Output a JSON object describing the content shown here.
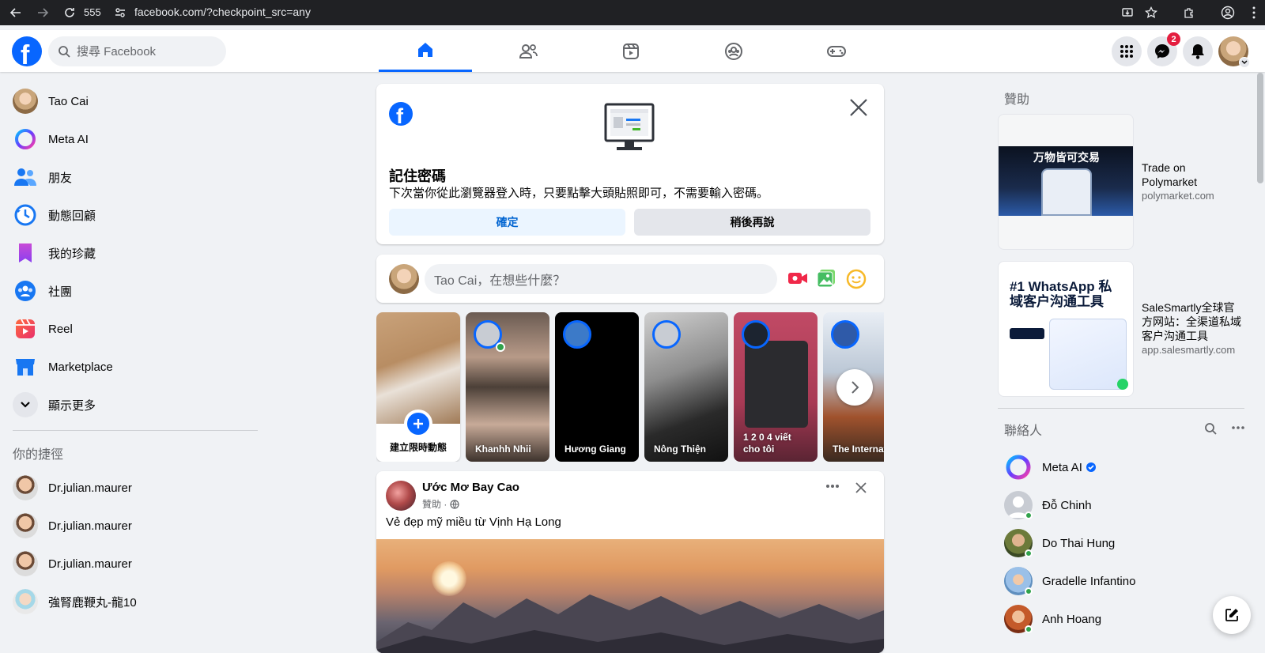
{
  "browser": {
    "tab_count": "555",
    "url": "facebook.com/?checkpoint_src=any"
  },
  "header": {
    "search_placeholder": "搜尋 Facebook",
    "messenger_badge": "2",
    "brand_color": "#0866ff",
    "nav_tabs": [
      "home-icon",
      "friends-icon",
      "video-icon",
      "groups-icon",
      "gaming-icon"
    ]
  },
  "sidebar": {
    "items": [
      {
        "label": "Tao Cai",
        "icon": "avatar"
      },
      {
        "label": "Meta AI",
        "icon": "meta-ai-icon"
      },
      {
        "label": "朋友",
        "icon": "friends-icon"
      },
      {
        "label": "動態回顧",
        "icon": "memories-icon"
      },
      {
        "label": "我的珍藏",
        "icon": "saved-icon"
      },
      {
        "label": "社團",
        "icon": "groups-icon"
      },
      {
        "label": "Reel",
        "icon": "reel-icon"
      },
      {
        "label": "Marketplace",
        "icon": "marketplace-icon"
      },
      {
        "label": "顯示更多",
        "icon": "chevron-down-icon"
      }
    ],
    "shortcuts_title": "你的捷徑",
    "shortcuts": [
      {
        "label": "Dr.julian.maurer"
      },
      {
        "label": "Dr.julian.maurer"
      },
      {
        "label": "Dr.julian.maurer"
      },
      {
        "label": "強腎鹿鞭丸-龍10"
      }
    ]
  },
  "password_card": {
    "title": "記住密碼",
    "description": "下次當你從此瀏覽器登入時，只要點擊大頭貼照即可，不需要輸入密碼。",
    "confirm_label": "確定",
    "later_label": "稍後再說"
  },
  "composer": {
    "placeholder": "Tao Cai，在想些什麼？"
  },
  "stories": {
    "create_label": "建立限時動態",
    "items": [
      {
        "name": "Khanhh Nhii"
      },
      {
        "name": "Hương Giang"
      },
      {
        "name": "Nông Thiện"
      },
      {
        "name": "1 2 0 4 viết cho tôi"
      },
      {
        "name": "The Internation"
      }
    ]
  },
  "post": {
    "author": "Ước Mơ Bay Cao",
    "meta": "贊助 ·",
    "text": "Vẻ đẹp mỹ miều từ Vịnh Hạ Long"
  },
  "sponsored": {
    "title": "贊助",
    "ads": [
      {
        "banner": "万物皆可交易",
        "title": "Trade on Polymarket",
        "domain": "polymarket.com"
      },
      {
        "banner": "#1 WhatsApp 私域客户沟通工具",
        "title": "SaleSmartly全球官方网站：全渠道私域客户沟通工具",
        "domain": "app.salesmartly.com"
      }
    ]
  },
  "contacts": {
    "title": "聯絡人",
    "items": [
      {
        "name": "Meta AI",
        "verified": true,
        "online": false
      },
      {
        "name": "Đỗ Chinh",
        "online": true
      },
      {
        "name": "Do Thai Hung",
        "online": true
      },
      {
        "name": "Gradelle Infantino",
        "online": true
      },
      {
        "name": "Anh Hoang",
        "online": true
      }
    ]
  }
}
